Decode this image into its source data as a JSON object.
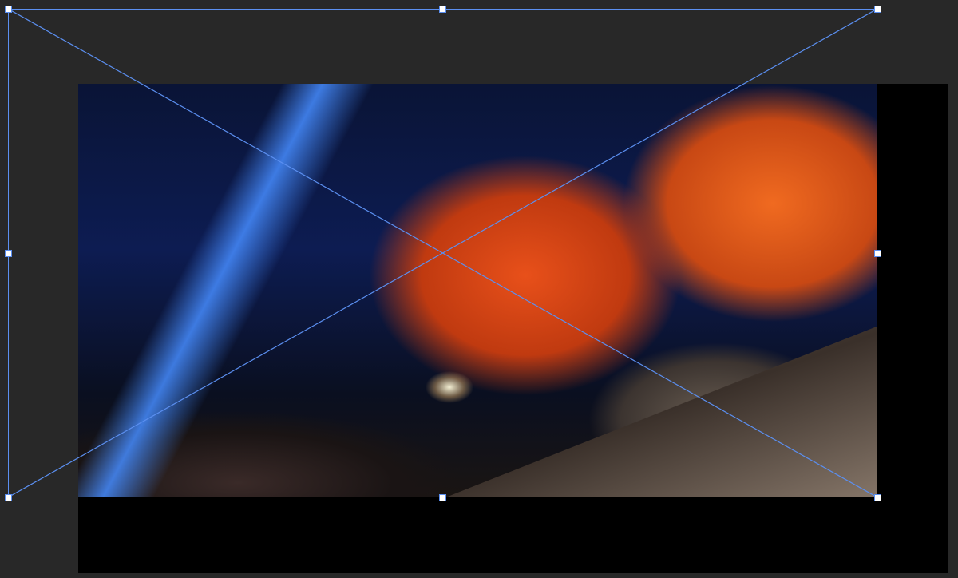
{
  "editor": {
    "mode": "transform"
  },
  "colors": {
    "background": "#282828",
    "selection": "#5b8ff0",
    "canvas": "#000000"
  }
}
